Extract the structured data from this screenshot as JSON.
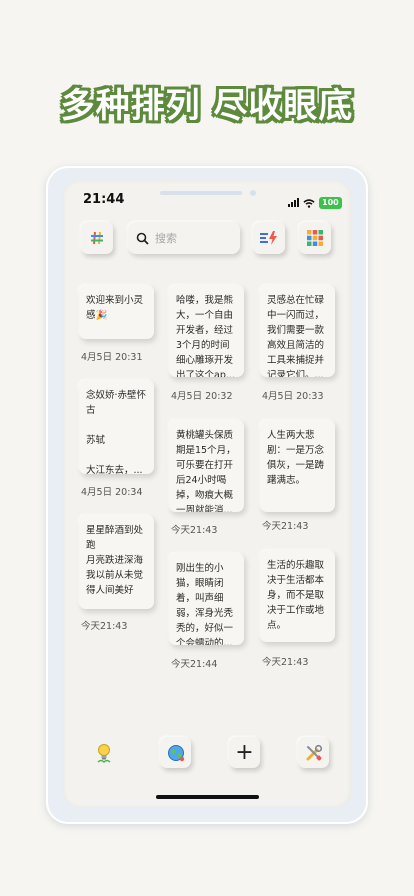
{
  "headline": "多种排列 尽收眼底",
  "status_bar": {
    "time": "21:44",
    "battery": "100"
  },
  "search": {
    "placeholder": "搜索"
  },
  "toolbar": {
    "left_icon": "hashtag-icon",
    "sort_icon": "sort-bolt-icon",
    "grid_icon": "grid-icon"
  },
  "notes": [
    {
      "text": "欢迎来到小灵感🎉",
      "date": "4月5日 20:31"
    },
    {
      "text": "念奴娇·赤壁怀古\n\n苏轼\n\n大江东去，...",
      "date": "4月5日 20:34"
    },
    {
      "text": "星星醉酒到处跑\n月亮跌进深海\n我以前从未觉得人间美好",
      "date": "今天21:43"
    },
    {
      "text": "哈喽，我是熊大，一个自由开发者，经过3个月的时间细心雕琢开发出了这个ap...",
      "date": "4月5日 20:32"
    },
    {
      "text": "黄桃罐头保质期是15个月，可乐要在打开后24小时喝掉，吻痕大概一周就能消...",
      "date": "今天21:43"
    },
    {
      "text": "刚出生的小猫，眼睛闭着，叫声细弱，浑身光秃秃的，好似一个会蠕动的...",
      "date": "今天21:44"
    },
    {
      "text": "灵感总在忙碌中一闪而过，我们需要一款高效且简洁的工具来捕捉并记录它们。...",
      "date": "4月5日 20:33"
    },
    {
      "text": "人生两大悲剧：一是万念俱灰，一是踌躇满志。",
      "date": "今天21:43"
    },
    {
      "text": "生活的乐趣取决于生活都本身，而不是取决于工作或地点。",
      "date": "今天21:43"
    }
  ],
  "bottom_bar": {
    "idea_icon": "lightbulb-icon",
    "globe_icon": "globe-icon",
    "add_label": "+",
    "tools_icon": "tools-icon"
  },
  "colors": {
    "headline_outline": "#5d8a3c",
    "battery": "#3cc24a",
    "background": "#f6f5f1"
  }
}
